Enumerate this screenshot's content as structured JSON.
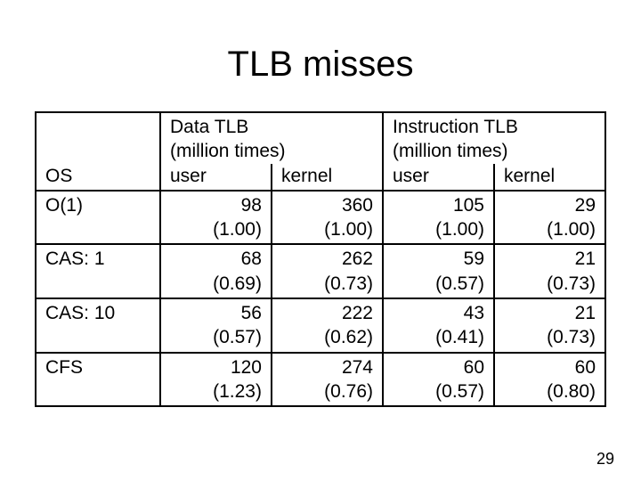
{
  "title": "TLB misses",
  "headers": {
    "os": "OS",
    "group1": "Data TLB\n(million times)",
    "group2": "Instruction TLB\n(million times)",
    "user": "user",
    "kernel": "kernel"
  },
  "rows": [
    {
      "os": "O(1)",
      "c": [
        "98\n(1.00)",
        "360\n(1.00)",
        "105\n(1.00)",
        "29\n(1.00)"
      ]
    },
    {
      "os": "CAS: 1",
      "c": [
        "68\n(0.69)",
        "262\n(0.73)",
        "59\n(0.57)",
        "21\n(0.73)"
      ]
    },
    {
      "os": "CAS: 10",
      "c": [
        "56\n(0.57)",
        "222\n(0.62)",
        "43\n(0.41)",
        "21\n(0.73)"
      ]
    },
    {
      "os": "CFS",
      "c": [
        "120\n(1.23)",
        "274\n(0.76)",
        "60\n(0.57)",
        "60\n(0.80)"
      ]
    }
  ],
  "page_number": "29",
  "chart_data": {
    "type": "table",
    "title": "TLB misses",
    "columns": [
      "OS",
      "Data TLB user (M)",
      "Data TLB kernel (M)",
      "Instruction TLB user (M)",
      "Instruction TLB kernel (M)"
    ],
    "series": [
      {
        "name": "O(1)",
        "values": [
          98,
          360,
          105,
          29
        ],
        "ratios": [
          1.0,
          1.0,
          1.0,
          1.0
        ]
      },
      {
        "name": "CAS: 1",
        "values": [
          68,
          262,
          59,
          21
        ],
        "ratios": [
          0.69,
          0.73,
          0.57,
          0.73
        ]
      },
      {
        "name": "CAS: 10",
        "values": [
          56,
          222,
          43,
          21
        ],
        "ratios": [
          0.57,
          0.62,
          0.41,
          0.73
        ]
      },
      {
        "name": "CFS",
        "values": [
          120,
          274,
          60,
          60
        ],
        "ratios": [
          1.23,
          0.76,
          0.57,
          0.8
        ]
      }
    ]
  }
}
